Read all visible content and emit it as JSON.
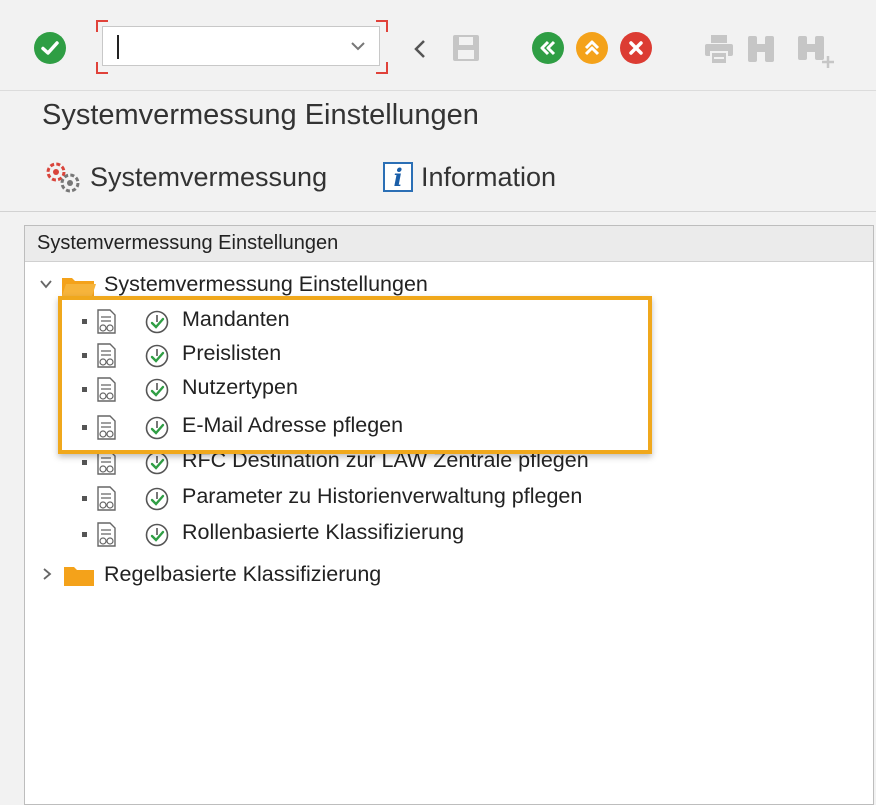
{
  "toolbar": {
    "command_field_value": "",
    "icons": [
      "enter-icon",
      "command-dropdown-icon",
      "collapse-icon",
      "save-icon",
      "back-icon",
      "exit-icon",
      "cancel-icon",
      "print-icon",
      "find-icon",
      "find-next-icon"
    ],
    "colors": {
      "green": "#2f9e44",
      "orange": "#f4a21a",
      "red": "#dc3c33",
      "disabled": "#c6c6c6"
    }
  },
  "title": "Systemvermessung Einstellungen",
  "app_toolbar": {
    "buttons": [
      {
        "label": "Systemvermessung",
        "icon": "settings-gear-icon"
      },
      {
        "label": "Information",
        "icon": "info-icon"
      }
    ]
  },
  "tree": {
    "header": "Systemvermessung Einstellungen",
    "root": {
      "label": "Systemvermessung Einstellungen",
      "expanded": true,
      "children": [
        {
          "label": "Mandanten"
        },
        {
          "label": "Preislisten"
        },
        {
          "label": "Nutzertypen"
        },
        {
          "label": "E-Mail Adresse pflegen"
        },
        {
          "label": "RFC Destination zur LAW Zentrale pflegen"
        },
        {
          "label": "Parameter zu Historienverwaltung pflegen"
        },
        {
          "label": "Rollenbasierte Klassifizierung"
        }
      ]
    },
    "second_root": {
      "label": "Regelbasierte Klassifizierung",
      "expanded": false
    },
    "highlight_color": "#f0a81c"
  }
}
